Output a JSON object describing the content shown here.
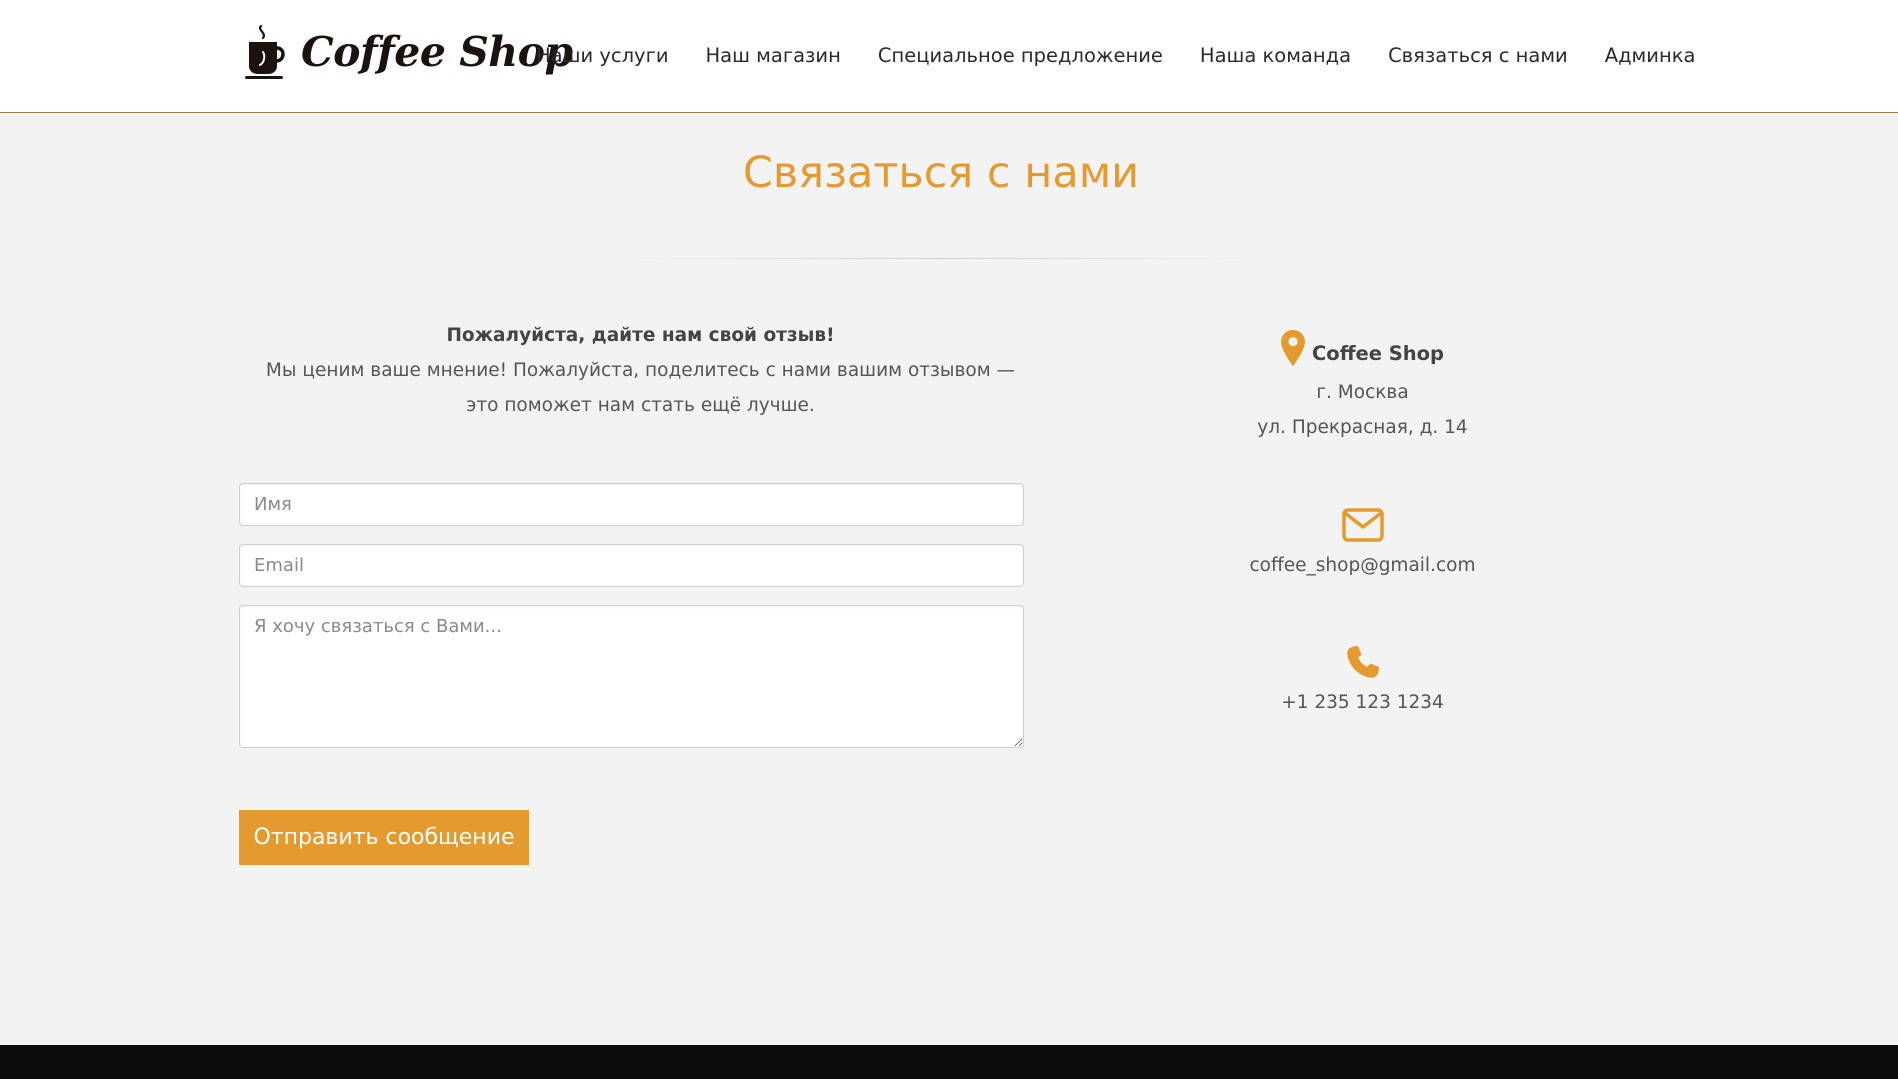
{
  "brand": {
    "logo_text": "Coffee Shop",
    "accent_color": "#e59a2f",
    "header_border_color": "#a07c47"
  },
  "nav": {
    "items": [
      {
        "label": "Наши услуги"
      },
      {
        "label": "Наш магазин"
      },
      {
        "label": "Специальное предложение"
      },
      {
        "label": "Наша команда"
      },
      {
        "label": "Связаться с нами"
      },
      {
        "label": "Админка"
      }
    ]
  },
  "page": {
    "title": "Связаться с нами"
  },
  "intro": {
    "heading": "Пожалуйста, дайте нам свой отзыв!",
    "body": "Мы ценим ваше мнение! Пожалуйста, поделитесь с нами вашим отзывом — это поможет нам стать ещё лучше."
  },
  "form": {
    "name_placeholder": "Имя",
    "email_placeholder": "Email",
    "message_placeholder": "Я хочу связаться с Вами...",
    "name_value": "",
    "email_value": "",
    "message_value": "",
    "submit_label": "Отправить сообщение"
  },
  "contact": {
    "shop_name": "Coffee Shop",
    "address_city": "г. Москва",
    "address_street": "ул. Прекрасная, д. 14",
    "email": "coffee_shop@gmail.com",
    "phone": "+1 235 123 1234",
    "icons": [
      "map-pin-icon",
      "envelope-icon",
      "phone-icon"
    ]
  }
}
